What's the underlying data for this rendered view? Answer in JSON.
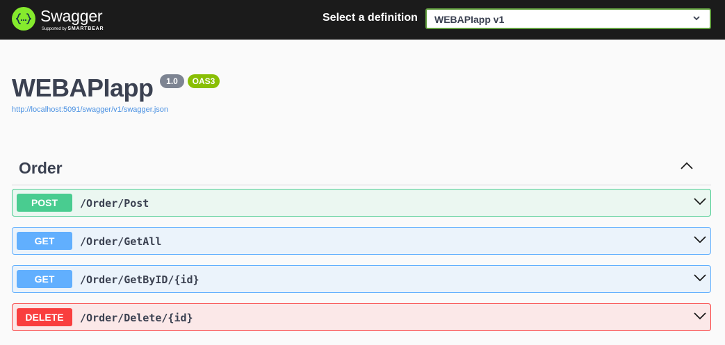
{
  "topbar": {
    "brand": "Swagger",
    "tagline_prefix": "Supported by",
    "tagline_company": "SMARTBEAR",
    "definition_label": "Select a definition",
    "definition_value": "WEBAPIapp v1"
  },
  "info": {
    "title": "WEBAPIapp",
    "version": "1.0",
    "spec_badge": "OAS3",
    "spec_url": "http://localhost:5091/swagger/v1/swagger.json"
  },
  "section": {
    "name": "Order",
    "expanded": true
  },
  "operations": [
    {
      "method": "POST",
      "path": "/Order/Post",
      "color": "#49cc90"
    },
    {
      "method": "GET",
      "path": "/Order/GetAll",
      "color": "#61affe"
    },
    {
      "method": "GET",
      "path": "/Order/GetByID/{id}",
      "color": "#61affe"
    },
    {
      "method": "DELETE",
      "path": "/Order/Delete/{id}",
      "color": "#f93e3e"
    }
  ],
  "colors": {
    "topbar_bg": "#1b1b1b",
    "brand_green": "#85ea2d",
    "link": "#4990e2"
  },
  "icons": {
    "logo": "swagger-braces-icon",
    "select_chevron": "chevron-down-icon",
    "section_toggle": "chevron-up-icon",
    "operation_expand": "chevron-down-icon"
  }
}
